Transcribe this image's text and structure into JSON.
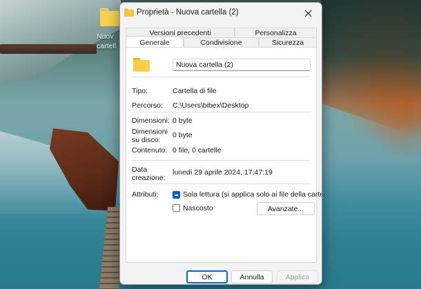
{
  "desktop": {
    "folder_label_line1": "Nuov",
    "folder_label_line2": "cartell"
  },
  "window": {
    "title": "Proprietà - Nuova cartella (2)",
    "close_icon": "close-icon"
  },
  "tabs": {
    "top": [
      "Versioni precedenti",
      "Personalizza"
    ],
    "bottom": [
      "Generale",
      "Condivisione",
      "Sicurezza"
    ],
    "active": "Generale"
  },
  "general": {
    "folder_name": "Nuova cartella (2)",
    "type_label": "Tipo:",
    "type_value": "Cartella di file",
    "path_label": "Percorso:",
    "path_value": "C:\\Users\\bibex\\Desktop",
    "size_label": "Dimensioni:",
    "size_value": "0 byte",
    "disk_size_label_1": "Dimensioni",
    "disk_size_label_2": "su disco:",
    "disk_size_value": "0 byte",
    "contents_label": "Contenuto:",
    "contents_value": "0 file, 0 cartelle",
    "created_label_1": "Data",
    "created_label_2": "creazione:",
    "created_value": "lunedì 29 aprile 2024, 17:47:19",
    "attributes_label": "Attributi:",
    "readonly_label": "Sola lettura (si applica solo ai file della cartella)",
    "readonly_state": "indeterminate",
    "hidden_label": "Nascosto",
    "hidden_state": "unchecked",
    "advanced_button": "Avanzate..."
  },
  "footer": {
    "ok": "OK",
    "cancel": "Annulla",
    "apply": "Applica"
  },
  "colors": {
    "accent": "#0a5ec7",
    "folder": "#f7cf4a"
  }
}
